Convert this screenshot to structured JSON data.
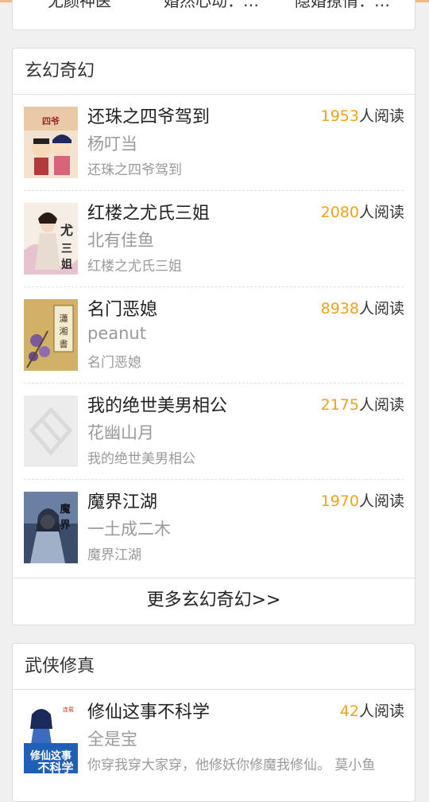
{
  "top_section": {
    "items": [
      "无颜神医",
      "婚然心动：…",
      "隐婚撩情：…"
    ]
  },
  "xuanhuan": {
    "title": "玄幻奇幻",
    "reads_suffix": "人阅读",
    "books": [
      {
        "title": "还珠之四爷驾到",
        "author": "杨叮当",
        "desc": "还珠之四爷驾到",
        "reads": "1953"
      },
      {
        "title": "红楼之尤氏三姐",
        "author": "北有佳鱼",
        "desc": "红楼之尤氏三姐",
        "reads": "2080"
      },
      {
        "title": "名门恶媳",
        "author": "peanut",
        "desc": "名门恶媳",
        "reads": "8938"
      },
      {
        "title": "我的绝世美男相公",
        "author": "花幽山月",
        "desc": "我的绝世美男相公",
        "reads": "2175"
      },
      {
        "title": "魔界江湖",
        "author": "一土成二木",
        "desc": "魔界江湖",
        "reads": "1970"
      }
    ],
    "more_label": "更多玄幻奇幻>>"
  },
  "wuxia": {
    "title": "武侠修真",
    "books": [
      {
        "title": "修仙这事不科学",
        "author": "全是宝",
        "desc": "你穿我穿大家穿，他修妖你修魔我修仙。 莫小鱼",
        "reads": "42"
      }
    ]
  },
  "colors": {
    "accent": "#f0a21c",
    "top_line": "#f6b787"
  },
  "icons": [
    "book-cover-placeholder-icon"
  ]
}
